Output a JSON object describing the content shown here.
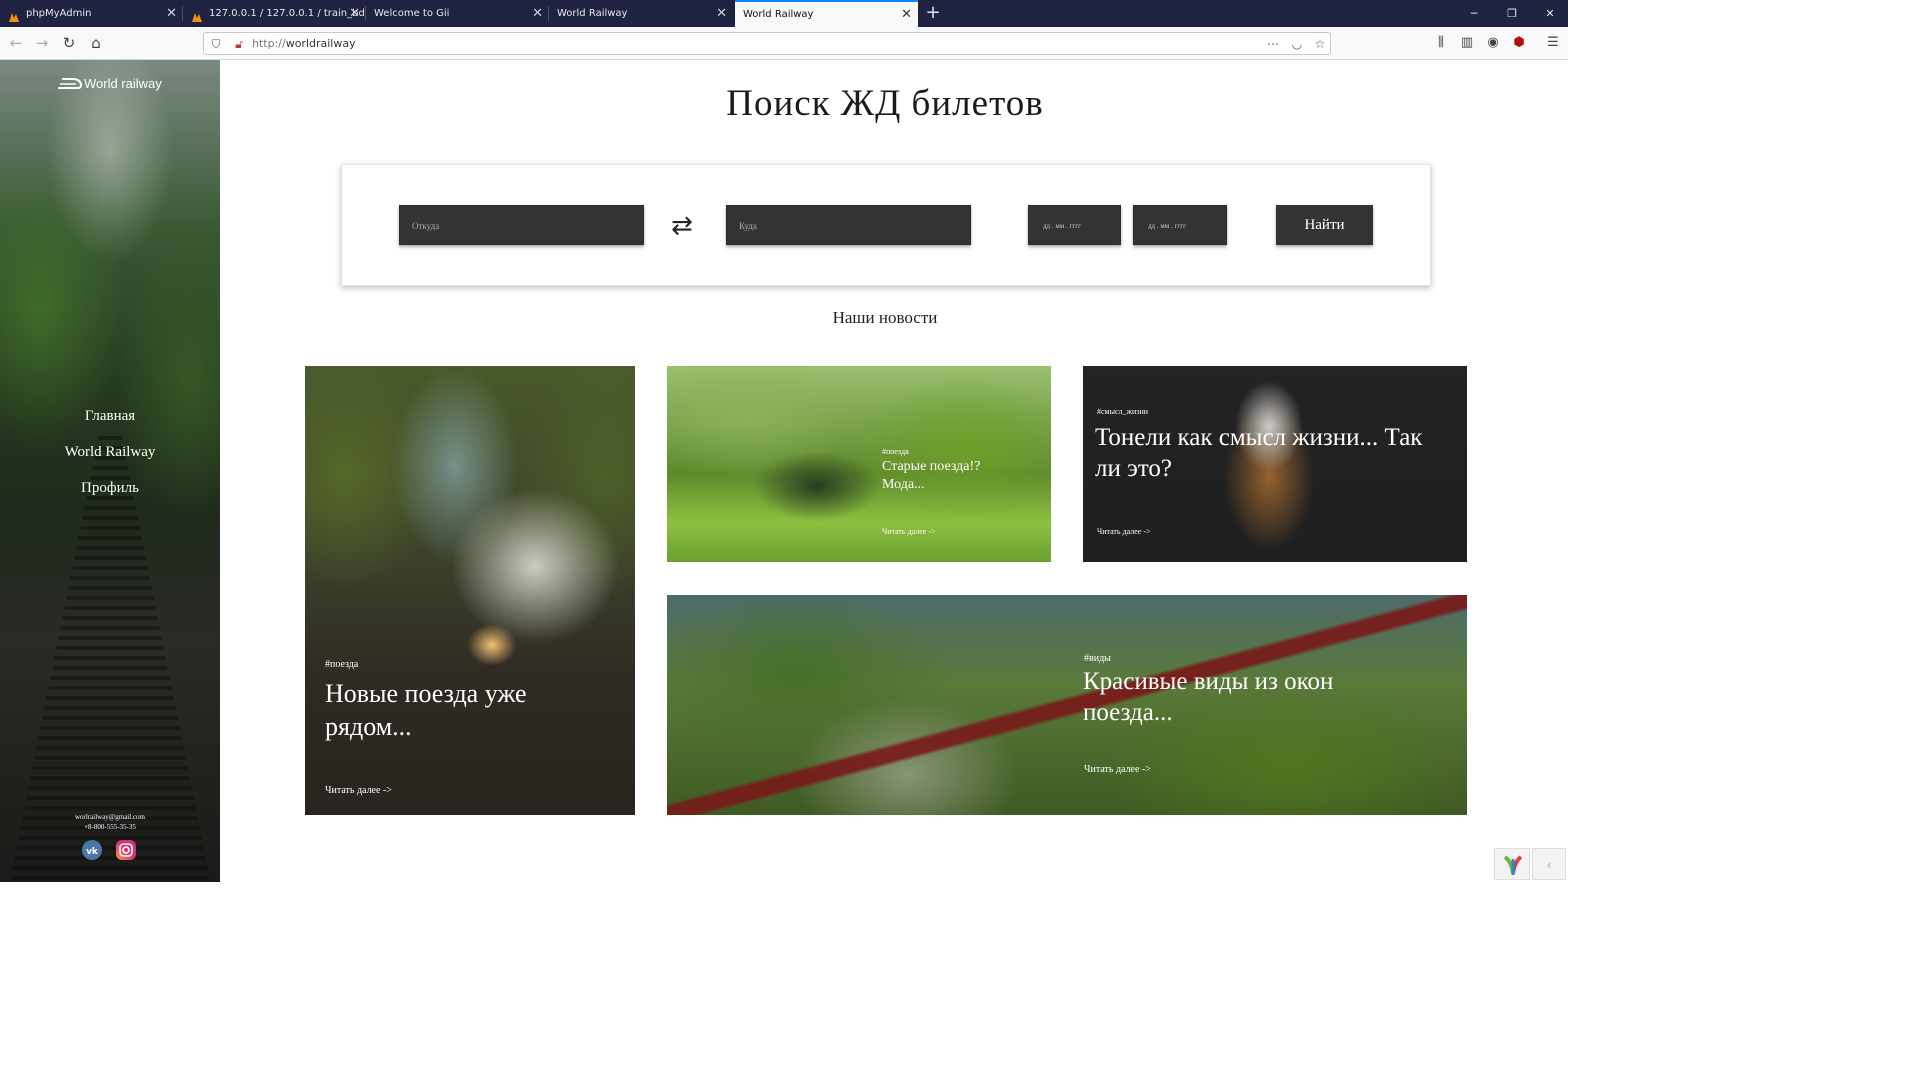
{
  "browser": {
    "tabs": [
      {
        "title": "phpMyAdmin"
      },
      {
        "title": "127.0.0.1 / 127.0.0.1 / train_bd |"
      },
      {
        "title": "Welcome to Gii"
      },
      {
        "title": "World Railway"
      },
      {
        "title": "World Railway"
      }
    ],
    "url_protocol": "http://",
    "url_host": "worldrailway",
    "icons": [
      "back-icon",
      "forward-icon",
      "reload-icon",
      "home-icon",
      "shield-icon",
      "insecure-icon",
      "more-icon",
      "pocket-icon",
      "star-icon",
      "library-icon",
      "sidebar-icon",
      "account-icon",
      "ublock-icon",
      "menu-icon"
    ]
  },
  "sidebar": {
    "logo_text": "World railway",
    "nav": [
      {
        "label": "Главная"
      },
      {
        "label": "World Railway"
      },
      {
        "label": "Профиль"
      }
    ],
    "email": "worlrailway@gmail.com",
    "phone": "+8-800-555-35-35",
    "social": [
      "vk-icon",
      "instagram-icon"
    ]
  },
  "page": {
    "title": "Поиск ЖД билетов",
    "search": {
      "from_placeholder": "Откуда",
      "to_placeholder": "Куда",
      "date1_placeholder": "дд . мм . гггг",
      "date2_placeholder": "дд . мм . гггг",
      "button_label": "Найти"
    },
    "news_heading": "Наши новости",
    "cards": [
      {
        "tag": "#поезда",
        "title": "Новые поезда уже рядом...",
        "more": "Читать далее ->"
      },
      {
        "tag": "#поезда",
        "title": "Старые поезда!? Мода...",
        "more": "Читать далее ->"
      },
      {
        "tag": "#смысл_жизни",
        "title": "Тонели как смысл жизни... Так ли это?",
        "more": "Читать далее ->"
      },
      {
        "tag": "#виды",
        "title": "Красивые виды из окон поезда...",
        "more": "Читать далее ->"
      }
    ]
  },
  "colors": {
    "tabbar": "#1f2240",
    "accent": "#0a84ff",
    "field_bg": "#333333"
  }
}
